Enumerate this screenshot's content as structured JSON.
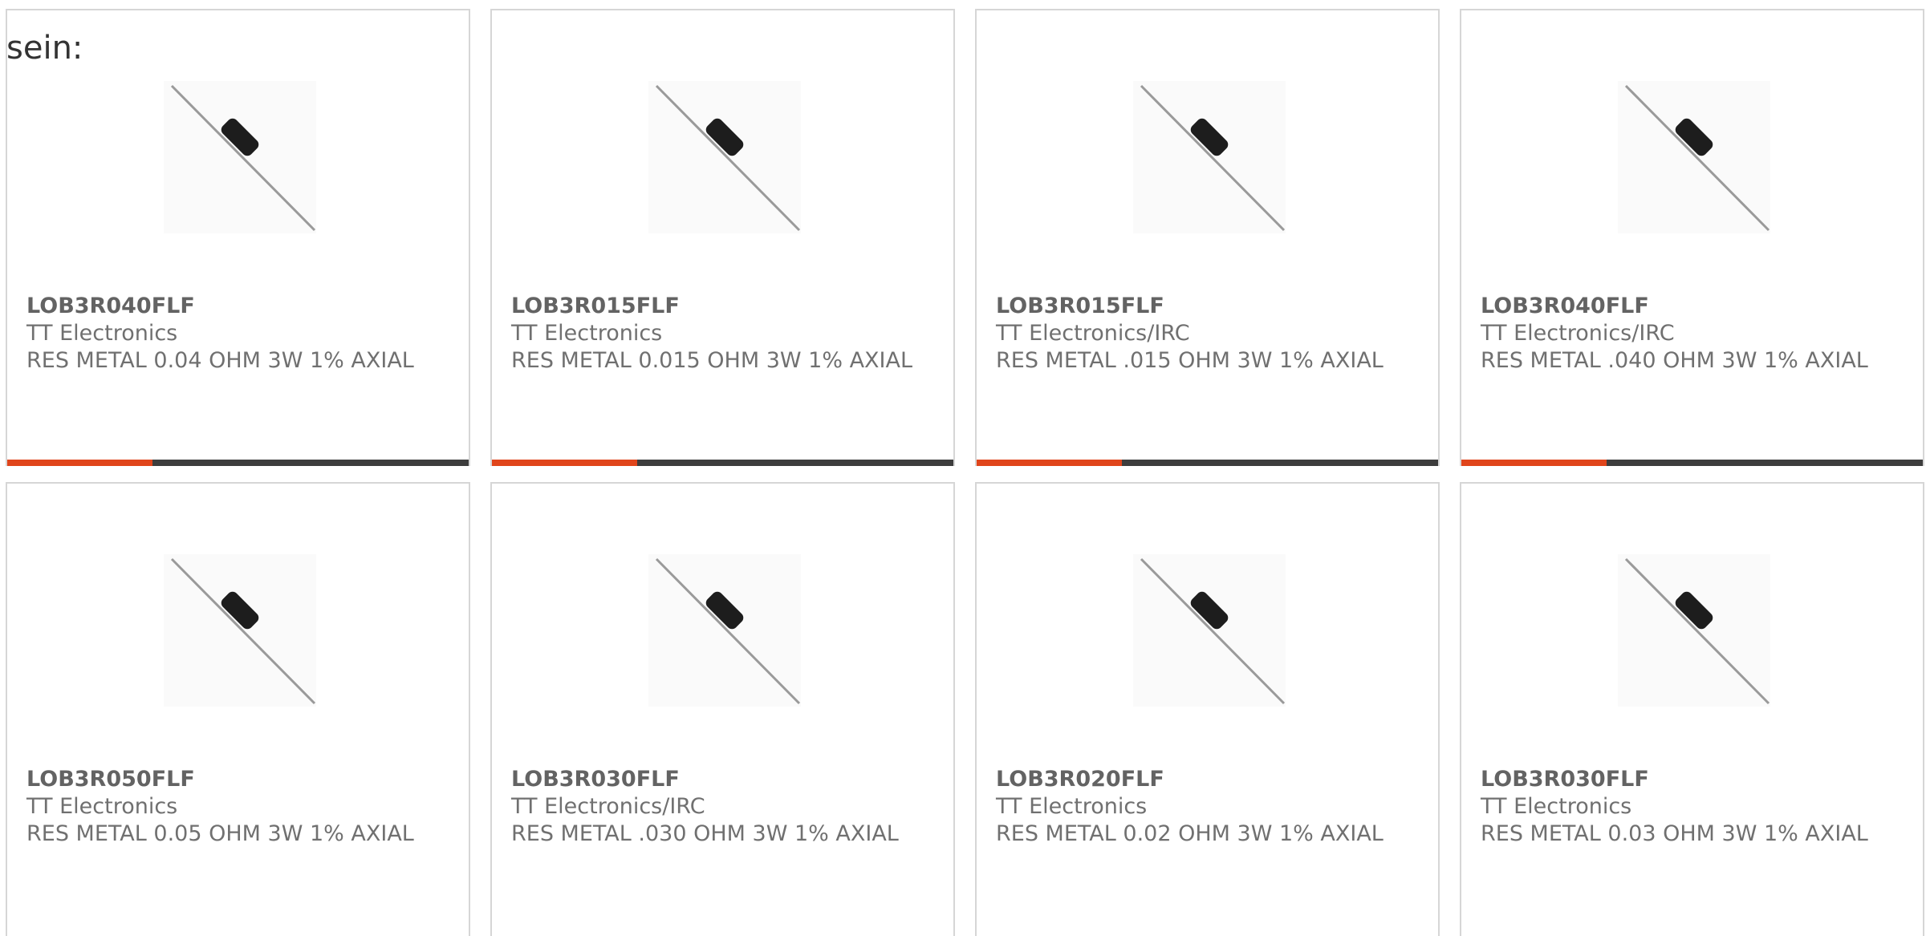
{
  "intro": {
    "text": "sein:"
  },
  "colors": {
    "accent": "#e0451b",
    "bar": "#3d3d3d",
    "border": "#d6d6d6",
    "text": "#707070"
  },
  "products": [
    {
      "part_number": "LOB3R040FLF",
      "manufacturer": "TT Electronics",
      "description": "RES METAL 0.04 OHM 3W 1% AXIAL",
      "image": "axial-resistor-icon"
    },
    {
      "part_number": "LOB3R015FLF",
      "manufacturer": "TT Electronics",
      "description": "RES METAL 0.015 OHM 3W 1% AXIAL",
      "image": "axial-resistor-icon"
    },
    {
      "part_number": "LOB3R015FLF",
      "manufacturer": "TT Electronics/IRC",
      "description": "RES METAL .015 OHM 3W 1% AXIAL",
      "image": "axial-resistor-icon"
    },
    {
      "part_number": "LOB3R040FLF",
      "manufacturer": "TT Electronics/IRC",
      "description": "RES METAL .040 OHM 3W 1% AXIAL",
      "image": "axial-resistor-icon"
    },
    {
      "part_number": "LOB3R050FLF",
      "manufacturer": "TT Electronics",
      "description": "RES METAL 0.05 OHM 3W 1% AXIAL",
      "image": "axial-resistor-icon"
    },
    {
      "part_number": "LOB3R030FLF",
      "manufacturer": "TT Electronics/IRC",
      "description": "RES METAL .030 OHM 3W 1% AXIAL",
      "image": "axial-resistor-icon"
    },
    {
      "part_number": "LOB3R020FLF",
      "manufacturer": "TT Electronics",
      "description": "RES METAL 0.02 OHM 3W 1% AXIAL",
      "image": "axial-resistor-icon"
    },
    {
      "part_number": "LOB3R030FLF",
      "manufacturer": "TT Electronics",
      "description": "RES METAL 0.03 OHM 3W 1% AXIAL",
      "image": "axial-resistor-icon"
    }
  ]
}
